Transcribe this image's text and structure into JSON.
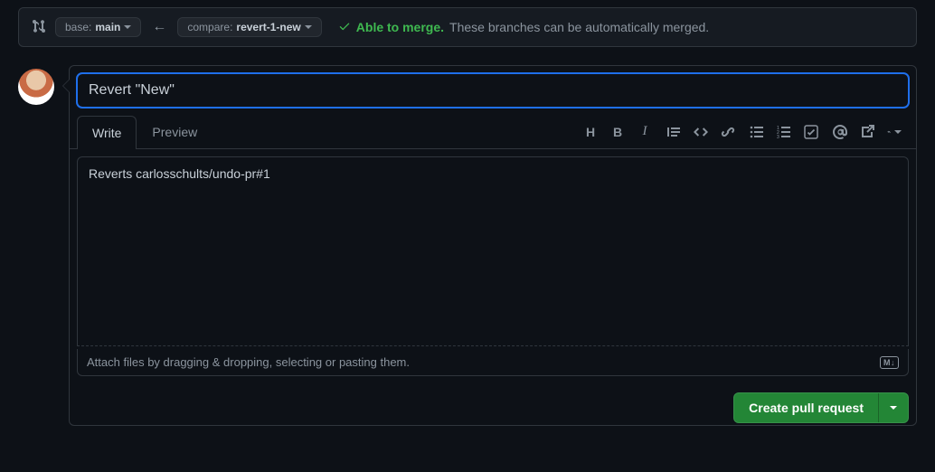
{
  "compare": {
    "base_prefix": "base:",
    "base_branch": "main",
    "compare_prefix": "compare:",
    "compare_branch": "revert-1-new"
  },
  "merge": {
    "able": "Able to merge.",
    "note": "These branches can be automatically merged."
  },
  "title": "Revert \"New\"",
  "tabs": {
    "write": "Write",
    "preview": "Preview"
  },
  "body": "Reverts carlosschults/undo-pr#1",
  "attach_hint": "Attach files by dragging & dropping, selecting or pasting them.",
  "md_badge": "M↓",
  "create_label": "Create pull request",
  "icons": {
    "heading": "H",
    "bold": "B",
    "italic": "I",
    "quote": "quote-icon",
    "code": "code-icon",
    "link": "link-icon",
    "ul": "list-unordered-icon",
    "ol": "list-ordered-icon",
    "task": "tasklist-icon",
    "mention": "mention-icon",
    "crossref": "cross-reference-icon",
    "reply": "reply-icon"
  }
}
